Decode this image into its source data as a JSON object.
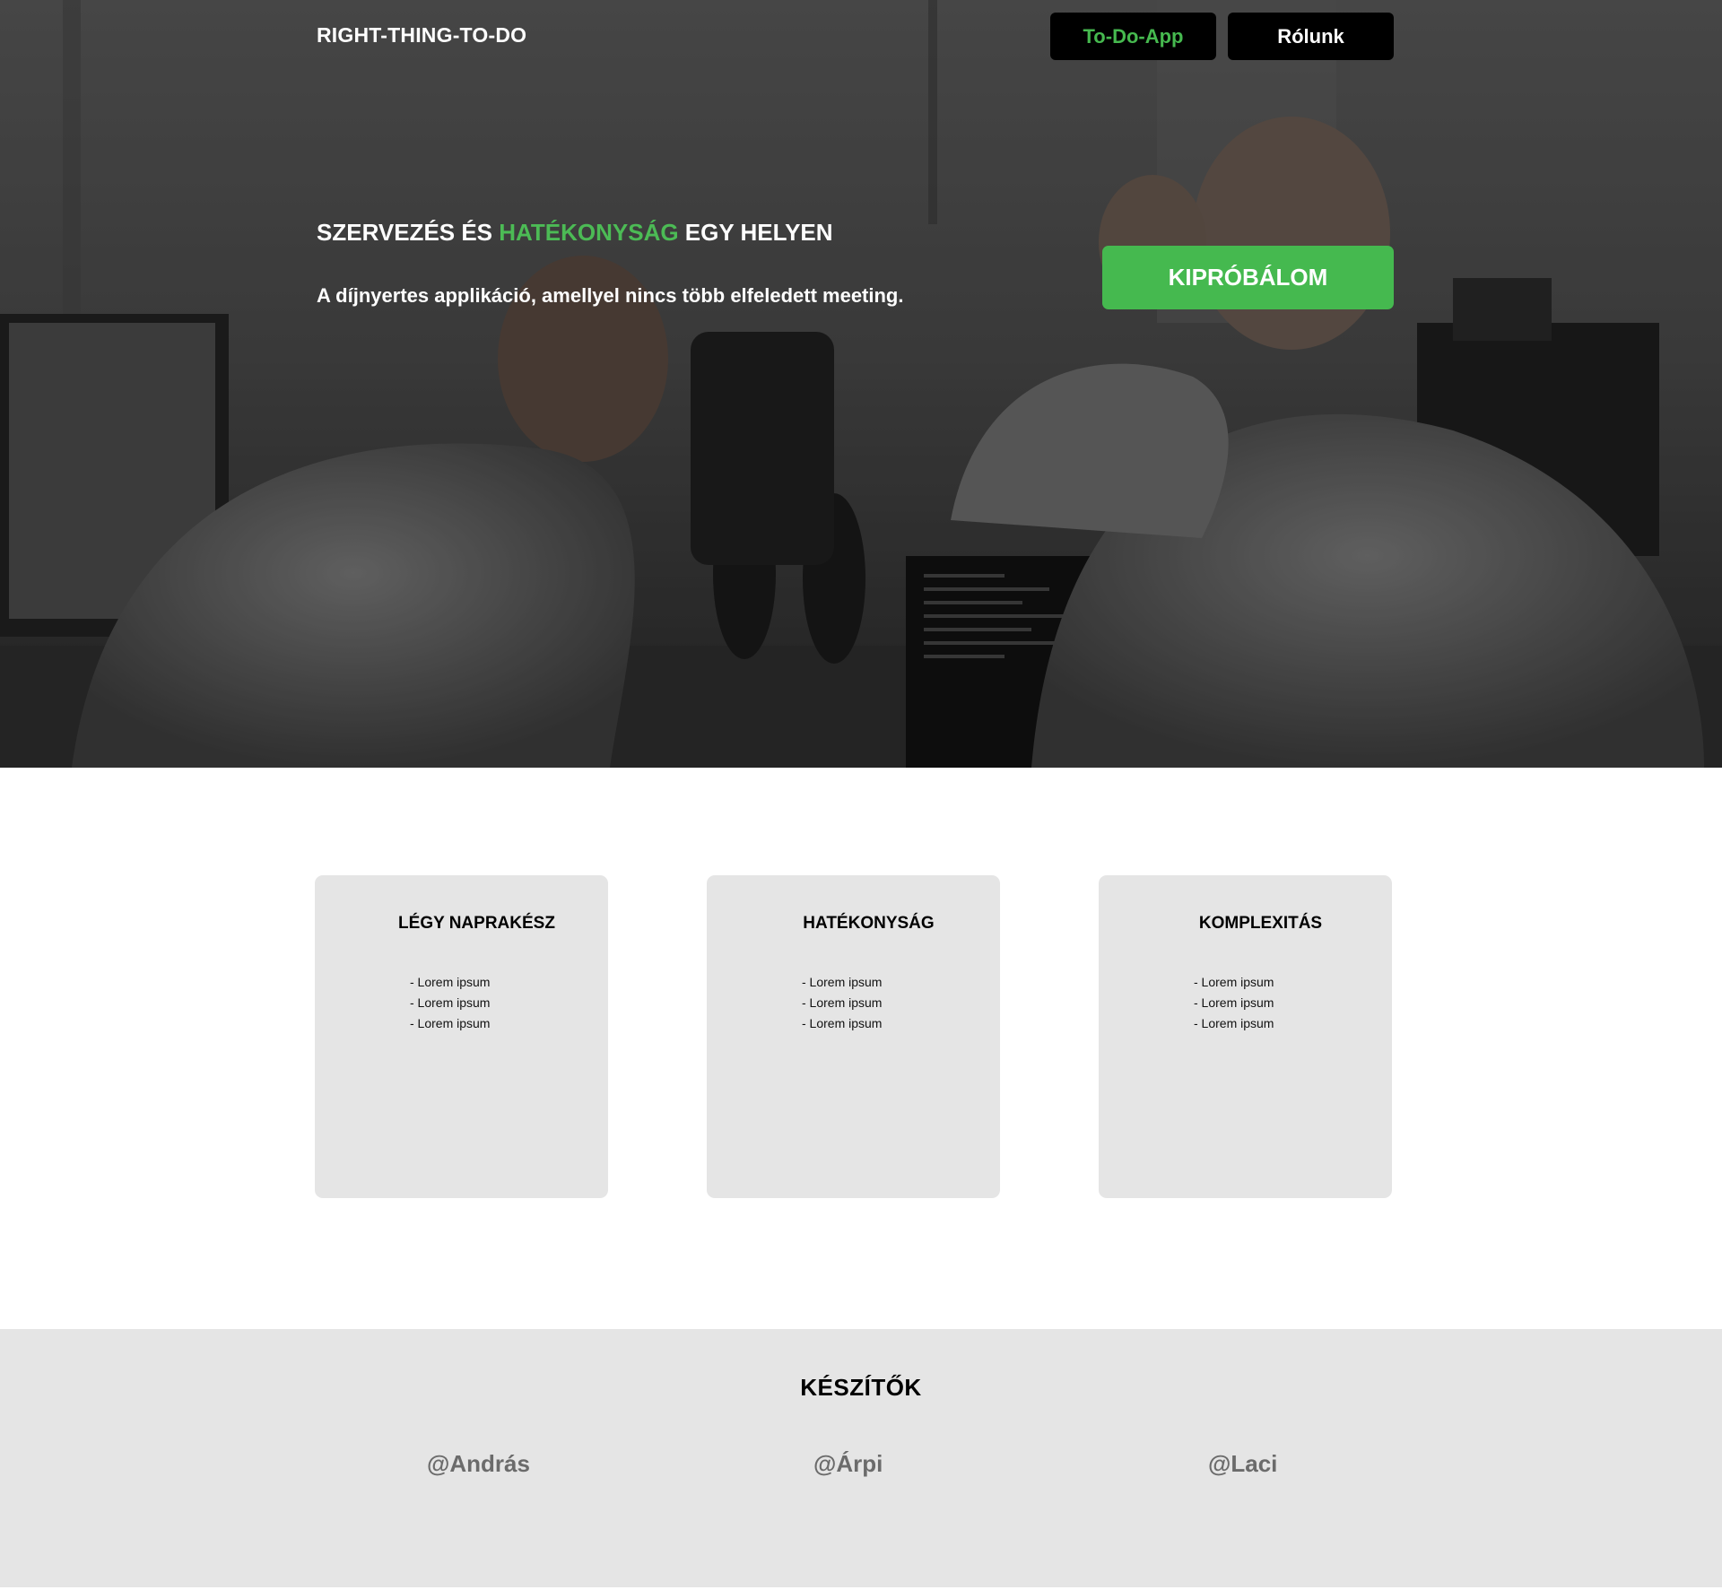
{
  "header": {
    "logo": "RIGHT-THING-TO-DO",
    "nav": [
      "To-Do-App",
      "Rólunk"
    ]
  },
  "hero": {
    "title_part1": "SZERVEZÉS ÉS ",
    "title_accent": "HATÉKONYSÁG",
    "title_part2": " EGY HELYEN",
    "subtitle": "A díjnyertes applikáció, amellyel nincs több elfeledett meeting.",
    "cta": "KIPRÓBÁLOM"
  },
  "features": [
    {
      "title": "LÉGY NAPRAKÉSZ",
      "items": [
        "- Lorem ipsum",
        "- Lorem ipsum",
        "- Lorem ipsum"
      ]
    },
    {
      "title": "HATÉKONYSÁG",
      "items": [
        "- Lorem ipsum",
        "- Lorem ipsum",
        "- Lorem ipsum"
      ]
    },
    {
      "title": "KOMPLEXITÁS",
      "items": [
        "- Lorem ipsum",
        "- Lorem ipsum",
        "- Lorem ipsum"
      ]
    }
  ],
  "footer": {
    "title": "KÉSZÍTŐK",
    "authors": [
      "@András",
      "@Árpi",
      "@Laci"
    ]
  },
  "colors": {
    "accent": "#4cbb55",
    "card_bg": "#e5e5e5",
    "nav_bg": "#000000"
  }
}
